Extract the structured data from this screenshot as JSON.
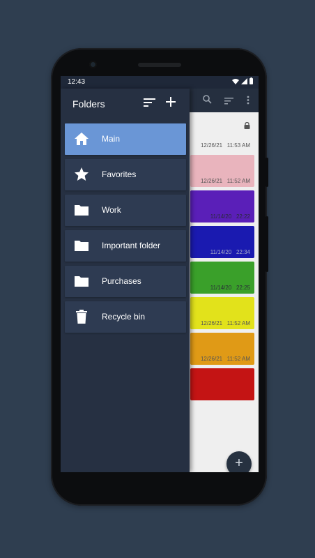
{
  "status_bar": {
    "time": "12:43"
  },
  "drawer": {
    "title": "Folders",
    "folders": [
      {
        "label": "Main",
        "icon": "home-icon",
        "active": true
      },
      {
        "label": "Favorites",
        "icon": "star-icon",
        "active": false
      },
      {
        "label": "Work",
        "icon": "folder-icon",
        "active": false
      },
      {
        "label": "Important folder",
        "icon": "folder-icon",
        "active": false
      },
      {
        "label": "Purchases",
        "icon": "folder-icon",
        "active": false
      },
      {
        "label": "Recycle bin",
        "icon": "trash-icon",
        "active": false
      }
    ]
  },
  "notes": [
    {
      "date": "12/26/21",
      "time": "11:53 AM",
      "color": "#efefef",
      "locked": true
    },
    {
      "date": "12/26/21",
      "time": "11:52 AM",
      "color": "#e9b4bd",
      "locked": false
    },
    {
      "date": "11/14/20",
      "time": "22:22",
      "color": "#5a1fb8",
      "locked": false
    },
    {
      "date": "11/14/20",
      "time": "22:34",
      "color": "#1a1ab0",
      "locked": false
    },
    {
      "date": "11/14/20",
      "time": "22:25",
      "color": "#3aa02a",
      "locked": false
    },
    {
      "date": "12/26/21",
      "time": "11:52 AM",
      "color": "#e2e21b",
      "locked": false
    },
    {
      "date": "12/26/21",
      "time": "11:52 AM",
      "color": "#e09a16",
      "locked": false
    },
    {
      "date": "",
      "time": "",
      "color": "#c41414",
      "locked": false
    }
  ],
  "colors": {
    "page_background": "#2f3e50",
    "drawer_background": "#263042",
    "folder_item": "#2e3b52",
    "folder_item_active": "#6a96d6"
  }
}
